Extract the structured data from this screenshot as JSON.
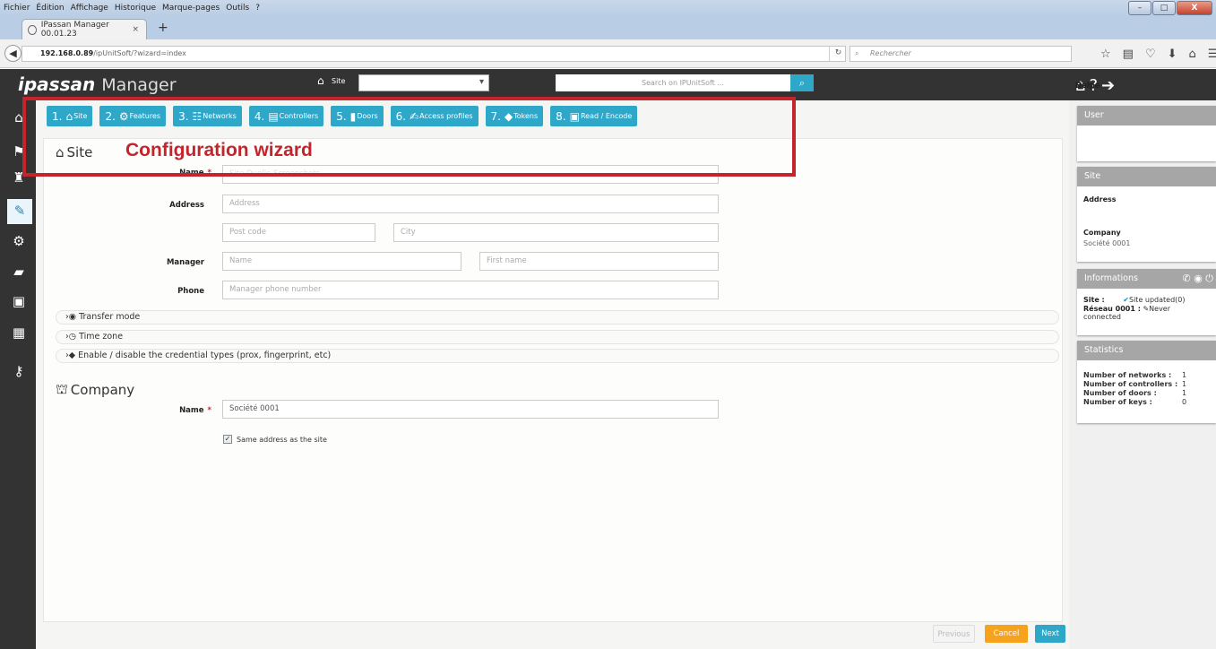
{
  "browser": {
    "menu": [
      "Fichier",
      "Édition",
      "Affichage",
      "Historique",
      "Marque-pages",
      "Outils",
      "?"
    ],
    "window_buttons": [
      "–",
      "□",
      "X"
    ],
    "tab_title": "IPassan Manager 00.01.23",
    "tab_close": "×",
    "new_tab": "+",
    "url_host": "192.168.0.89",
    "url_path": "/ipUnitSoft/?wizard=index",
    "search_placeholder": "Rechercher",
    "toolbar_icons": [
      "star-icon",
      "bookmarks-icon",
      "pocket-icon",
      "download-icon",
      "home-icon",
      "menu-icon"
    ]
  },
  "header": {
    "logo_brand": "ipassan",
    "logo_suffix": "Manager",
    "site_label": "Site",
    "site_value": "",
    "search_placeholder": "Search on IPUnitSoft ...",
    "nav": [
      {
        "label": "Home",
        "icon": "home-icon"
      },
      {
        "label": "Help",
        "icon": "help-icon"
      },
      {
        "label": "Quit",
        "icon": "quit-icon"
      }
    ]
  },
  "sidebar": {
    "icons": [
      "home-icon",
      "sites-icon",
      "building-icon",
      "site-edit-icon",
      "gears-icon",
      "book-icon",
      "monitor-icon",
      "toolbox-icon",
      "key-icon"
    ],
    "active_index": 3
  },
  "wizard": {
    "steps": [
      {
        "num": "1.",
        "label": "Site"
      },
      {
        "num": "2.",
        "label": "Features"
      },
      {
        "num": "3.",
        "label": "Networks"
      },
      {
        "num": "4.",
        "label": "Controllers"
      },
      {
        "num": "5.",
        "label": "Doors"
      },
      {
        "num": "6.",
        "label": "Access profiles"
      },
      {
        "num": "7.",
        "label": "Tokens"
      },
      {
        "num": "8.",
        "label": "Read / Encode"
      }
    ],
    "annotation": "Configuration wizard"
  },
  "site_form": {
    "title": "Site",
    "name_label": "Name",
    "name_value": "Site Quelle Screenshots",
    "address_label": "Address",
    "address_placeholder": "Address",
    "postcode_placeholder": "Post code",
    "city_placeholder": "City",
    "manager_label": "Manager",
    "manager_name_placeholder": "Name",
    "manager_firstname_placeholder": "First name",
    "phone_label": "Phone",
    "phone_placeholder": "Manager phone number"
  },
  "sections": {
    "transfer_mode": "Transfer mode",
    "time_zone": "Time zone",
    "credential_types": "Enable / disable the credential types (prox, fingerprint, etc)"
  },
  "company_form": {
    "title": "Company",
    "name_label": "Name",
    "name_value": "Société 0001",
    "same_address_label": "Same address as the site",
    "same_address_checked": true
  },
  "buttons": {
    "previous": "Previous",
    "cancel": "Cancel",
    "next": "Next"
  },
  "right_panel": {
    "user": {
      "title": "User",
      "value": ""
    },
    "site": {
      "title": "Site",
      "address_label": "Address",
      "company_label": "Company",
      "company_value": "Société 0001"
    },
    "info": {
      "title": "Informations",
      "site_label": "Site :",
      "site_value": "Site updated(0)",
      "network_label": "Réseau 0001 :",
      "network_value": "Never connected"
    },
    "stats": {
      "title": "Statistics",
      "rows": [
        {
          "label": "Number of networks :",
          "value": "1"
        },
        {
          "label": "Number of controllers :",
          "value": "1"
        },
        {
          "label": "Number of doors :",
          "value": "1"
        },
        {
          "label": "Number of keys :",
          "value": "0"
        }
      ]
    }
  },
  "colors": {
    "accent": "#2ea7c9",
    "header_bg": "#333333",
    "annotation_red": "#c5242c",
    "cancel_orange": "#f7a21c",
    "panel_header_gray": "#a6a6a6"
  }
}
